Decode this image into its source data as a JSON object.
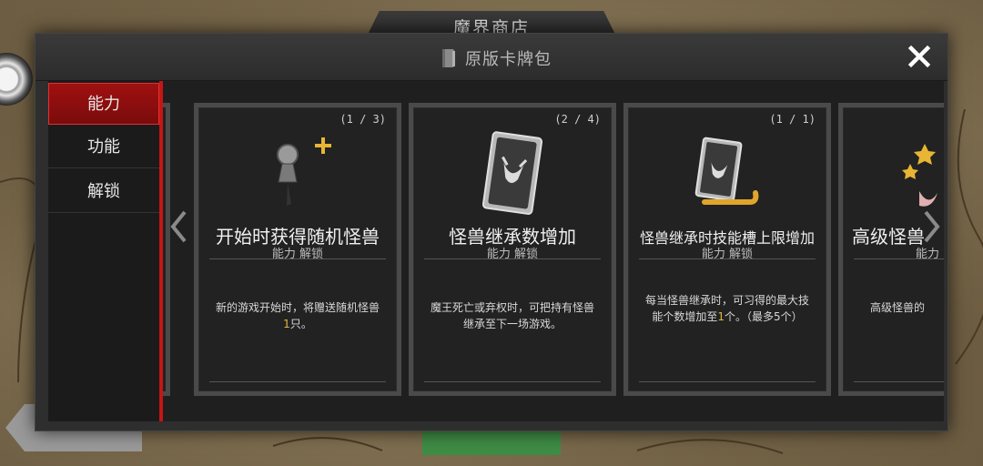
{
  "background": {
    "shop_tab_title": "魔界商店"
  },
  "modal": {
    "title": "原版卡牌包",
    "close_label": "X"
  },
  "sidebar": {
    "items": [
      {
        "label": "能力",
        "active": true
      },
      {
        "label": "功能",
        "active": false
      },
      {
        "label": "解锁",
        "active": false
      }
    ]
  },
  "cards": [
    {
      "count": "(1 / 3)",
      "title": "开始时获得随机怪兽",
      "subtitle": "能力 解锁",
      "desc_before": "新的游戏开始时，将赠送随机怪兽",
      "desc_highlight": "1",
      "desc_after": "只。",
      "icon": "pin-plus-icon"
    },
    {
      "count": "(2 / 4)",
      "title": "怪兽继承数增加",
      "subtitle": "能力 解锁",
      "desc_before": "魔王死亡或弃权时，可把持有怪兽继承至下一场游戏。",
      "desc_highlight": "",
      "desc_after": "",
      "icon": "monster-card-icon"
    },
    {
      "count": "(1 / 1)",
      "title": "怪兽继承时技能槽上限增加",
      "subtitle": "能力 解锁",
      "desc_before": "每当怪兽继承时，可习得的最大技能个数增加至",
      "desc_highlight": "1",
      "desc_after": "个。（最多5个）",
      "icon": "monster-scroll-icon"
    },
    {
      "count": "",
      "title": "高级怪兽",
      "subtitle": "能力",
      "desc_before": "高级怪兽的",
      "desc_highlight": "",
      "desc_after": "",
      "icon": "stars-monster-icon"
    }
  ],
  "colors": {
    "accent_red": "#c81414",
    "highlight_gold": "#e2b93b",
    "panel_bg": "#2e2e2e"
  }
}
